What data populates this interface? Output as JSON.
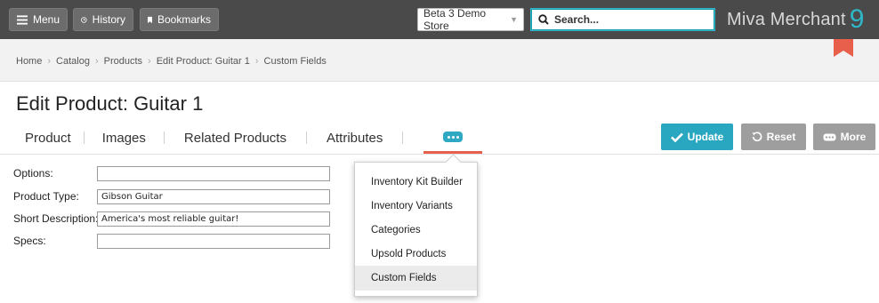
{
  "topbar": {
    "menu_label": "Menu",
    "history_label": "History",
    "bookmarks_label": "Bookmarks",
    "store_selected": "Beta 3 Demo Store",
    "search_placeholder": "Search...",
    "brand_name": "Miva Merchant",
    "brand_version": "9"
  },
  "breadcrumb": [
    "Home",
    "Catalog",
    "Products",
    "Edit Product: Guitar 1",
    "Custom Fields"
  ],
  "page": {
    "title": "Edit Product: Guitar 1"
  },
  "tabs": [
    "Product",
    "Images",
    "Related Products",
    "Attributes"
  ],
  "actions": {
    "update": "Update",
    "reset": "Reset",
    "more": "More"
  },
  "form": {
    "options_label": "Options:",
    "options_value": "",
    "product_type_label": "Product Type:",
    "product_type_value": "Gibson Guitar",
    "short_description_label": "Short Description:",
    "short_description_value": "America's most reliable guitar!",
    "specs_label": "Specs:",
    "specs_value": ""
  },
  "more_menu": {
    "items": [
      "Inventory Kit Builder",
      "Inventory Variants",
      "Categories",
      "Upsold Products",
      "Custom Fields"
    ],
    "active": "Custom Fields"
  },
  "colors": {
    "accent": "#2aa7c0",
    "tab_indicator": "#e8604c",
    "topbar": "#4a4a4a"
  }
}
